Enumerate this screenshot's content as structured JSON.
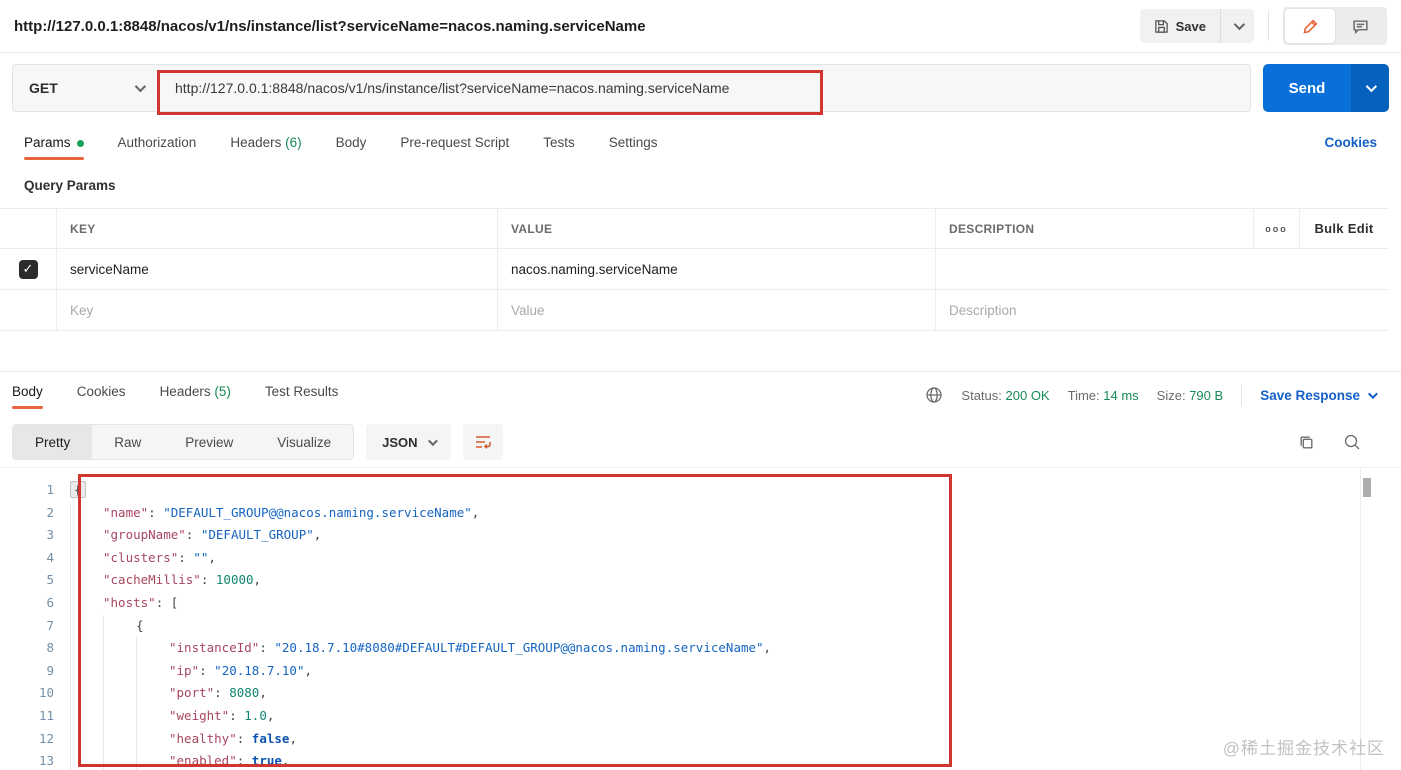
{
  "topbar": {
    "title": "http://127.0.0.1:8848/nacos/v1/ns/instance/list?serviceName=nacos.naming.serviceName",
    "save_label": "Save"
  },
  "request": {
    "method": "GET",
    "url": "http://127.0.0.1:8848/nacos/v1/ns/instance/list?serviceName=nacos.naming.serviceName",
    "send_label": "Send"
  },
  "request_tabs": {
    "items": [
      {
        "label": "Params",
        "active": true
      },
      {
        "label": "Authorization"
      },
      {
        "label": "Headers",
        "count": "(6)"
      },
      {
        "label": "Body"
      },
      {
        "label": "Pre-request Script"
      },
      {
        "label": "Tests"
      },
      {
        "label": "Settings"
      }
    ],
    "cookies_link": "Cookies"
  },
  "query_params": {
    "title": "Query Params",
    "headers": {
      "key": "KEY",
      "value": "VALUE",
      "description": "DESCRIPTION"
    },
    "more_label": "ooo",
    "bulk_edit_label": "Bulk Edit",
    "rows": [
      {
        "key": "serviceName",
        "value": "nacos.naming.serviceName",
        "description": "",
        "checked": true
      }
    ],
    "placeholders": {
      "key": "Key",
      "value": "Value",
      "description": "Description"
    }
  },
  "icons": {
    "check": "✓"
  },
  "response": {
    "tabs": [
      {
        "label": "Body",
        "active": true
      },
      {
        "label": "Cookies"
      },
      {
        "label": "Headers",
        "count": "(5)"
      },
      {
        "label": "Test Results"
      }
    ],
    "status_label": "Status:",
    "status_value": "200 OK",
    "time_label": "Time:",
    "time_value": "14 ms",
    "size_label": "Size:",
    "size_value": "790 B",
    "save_response_label": "Save Response",
    "view_tabs": [
      {
        "label": "Pretty",
        "active": true
      },
      {
        "label": "Raw"
      },
      {
        "label": "Preview"
      },
      {
        "label": "Visualize"
      }
    ],
    "format_label": "JSON",
    "code": {
      "lines": [
        {
          "n": 1,
          "i": 0,
          "t": [
            [
              "box",
              "{"
            ]
          ]
        },
        {
          "n": 2,
          "i": 1,
          "t": [
            [
              "k",
              "\"name\""
            ],
            [
              "p",
              ": "
            ],
            [
              "s",
              "\"DEFAULT_GROUP@@nacos.naming.serviceName\""
            ],
            [
              "p",
              ","
            ]
          ]
        },
        {
          "n": 3,
          "i": 1,
          "t": [
            [
              "k",
              "\"groupName\""
            ],
            [
              "p",
              ": "
            ],
            [
              "s",
              "\"DEFAULT_GROUP\""
            ],
            [
              "p",
              ","
            ]
          ]
        },
        {
          "n": 4,
          "i": 1,
          "t": [
            [
              "k",
              "\"clusters\""
            ],
            [
              "p",
              ": "
            ],
            [
              "s",
              "\"\""
            ],
            [
              "p",
              ","
            ]
          ]
        },
        {
          "n": 5,
          "i": 1,
          "t": [
            [
              "k",
              "\"cacheMillis\""
            ],
            [
              "p",
              ": "
            ],
            [
              "n",
              "10000"
            ],
            [
              "p",
              ","
            ]
          ]
        },
        {
          "n": 6,
          "i": 1,
          "t": [
            [
              "k",
              "\"hosts\""
            ],
            [
              "p",
              ": "
            ],
            [
              "p",
              "["
            ]
          ]
        },
        {
          "n": 7,
          "i": 2,
          "t": [
            [
              "p",
              "{"
            ]
          ]
        },
        {
          "n": 8,
          "i": 3,
          "t": [
            [
              "k",
              "\"instanceId\""
            ],
            [
              "p",
              ": "
            ],
            [
              "s",
              "\"20.18.7.10#8080#DEFAULT#DEFAULT_GROUP@@nacos.naming.serviceName\""
            ],
            [
              "p",
              ","
            ]
          ]
        },
        {
          "n": 9,
          "i": 3,
          "t": [
            [
              "k",
              "\"ip\""
            ],
            [
              "p",
              ": "
            ],
            [
              "s",
              "\"20.18.7.10\""
            ],
            [
              "p",
              ","
            ]
          ]
        },
        {
          "n": 10,
          "i": 3,
          "t": [
            [
              "k",
              "\"port\""
            ],
            [
              "p",
              ": "
            ],
            [
              "n",
              "8080"
            ],
            [
              "p",
              ","
            ]
          ]
        },
        {
          "n": 11,
          "i": 3,
          "t": [
            [
              "k",
              "\"weight\""
            ],
            [
              "p",
              ": "
            ],
            [
              "n",
              "1.0"
            ],
            [
              "p",
              ","
            ]
          ]
        },
        {
          "n": 12,
          "i": 3,
          "t": [
            [
              "k",
              "\"healthy\""
            ],
            [
              "p",
              ": "
            ],
            [
              "b",
              "false"
            ],
            [
              "p",
              ","
            ]
          ]
        },
        {
          "n": 13,
          "i": 3,
          "t": [
            [
              "k",
              "\"enabled\""
            ],
            [
              "p",
              ": "
            ],
            [
              "b",
              "true"
            ],
            [
              "p",
              ","
            ]
          ]
        }
      ]
    }
  },
  "watermark": "@稀土掘金技术社区",
  "colors": {
    "accent_orange": "#e8663d",
    "link_blue": "#1460c8",
    "status_green": "#188a56",
    "send_blue": "#0870d8",
    "annotation_red": "#cf3630"
  }
}
